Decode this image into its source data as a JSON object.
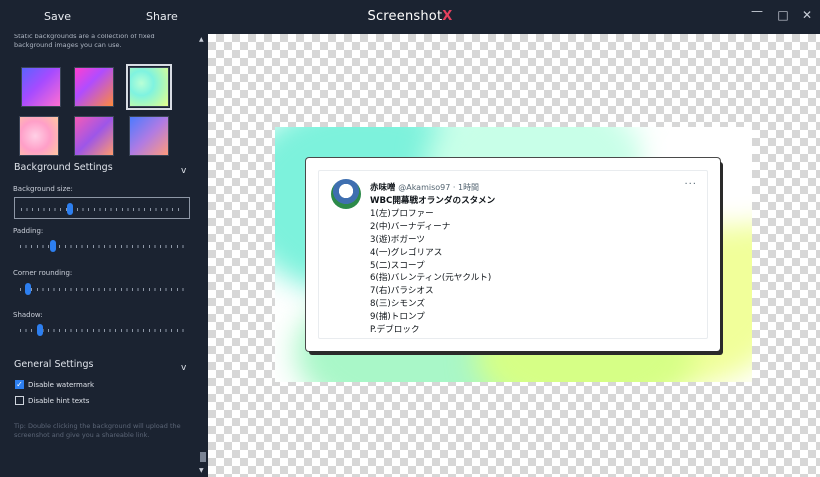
{
  "titlebar": {
    "save_label": "Save",
    "share_label": "Share",
    "app_title": "Screenshot",
    "app_title_mark": "X",
    "minimize": "—",
    "maximize": "□",
    "close": "✕"
  },
  "sidebar": {
    "static_note": "Static backgrounds are a collection of fixed background images you can use.",
    "backgrounds": [
      {
        "name": "blue-purple-gradient",
        "selected": false
      },
      {
        "name": "magenta-orange-gradient",
        "selected": false
      },
      {
        "name": "mint-lime-gradient",
        "selected": true
      },
      {
        "name": "pink-peach-gradient",
        "selected": false
      },
      {
        "name": "pink-violet-gradient",
        "selected": false
      },
      {
        "name": "blue-coral-gradient",
        "selected": false
      }
    ],
    "background_settings": {
      "title": "Background Settings",
      "chevron": "v",
      "size_label": "Background size:",
      "size_value": 0.3,
      "padding_label": "Padding:",
      "padding_value": 0.2,
      "corner_label": "Corner rounding:",
      "corner_value": 0.05,
      "shadow_label": "Shadow:",
      "shadow_value": 0.12
    },
    "general_settings": {
      "title": "General Settings",
      "chevron": "v",
      "disable_watermark_label": "Disable watermark",
      "disable_watermark_checked": true,
      "disable_hint_label": "Disable hint texts",
      "disable_hint_checked": false
    },
    "tip": "Tip: Double clicking the background will upload the screenshot and give you a shareable link."
  },
  "tweet": {
    "name": "赤味噌",
    "handle": "@Akamiso97 · 1時間",
    "more": "···",
    "lines": [
      "WBC開幕戦オランダのスタメン",
      "1(左)プロファー",
      "2(中)バーナディーナ",
      "3(遊)ボガーツ",
      "4(一)グレゴリアス",
      "5(二)スコープ",
      "6(指)バレンティン(元ヤクルト)",
      "7(右)パラシオス",
      "8(三)シモンズ",
      "9(捕)トロンプ",
      "P.デブロック"
    ]
  },
  "colors": {
    "sidebar_bg": "#1b2331",
    "accent": "#2d7ff0",
    "title_x": "#e5405e"
  }
}
